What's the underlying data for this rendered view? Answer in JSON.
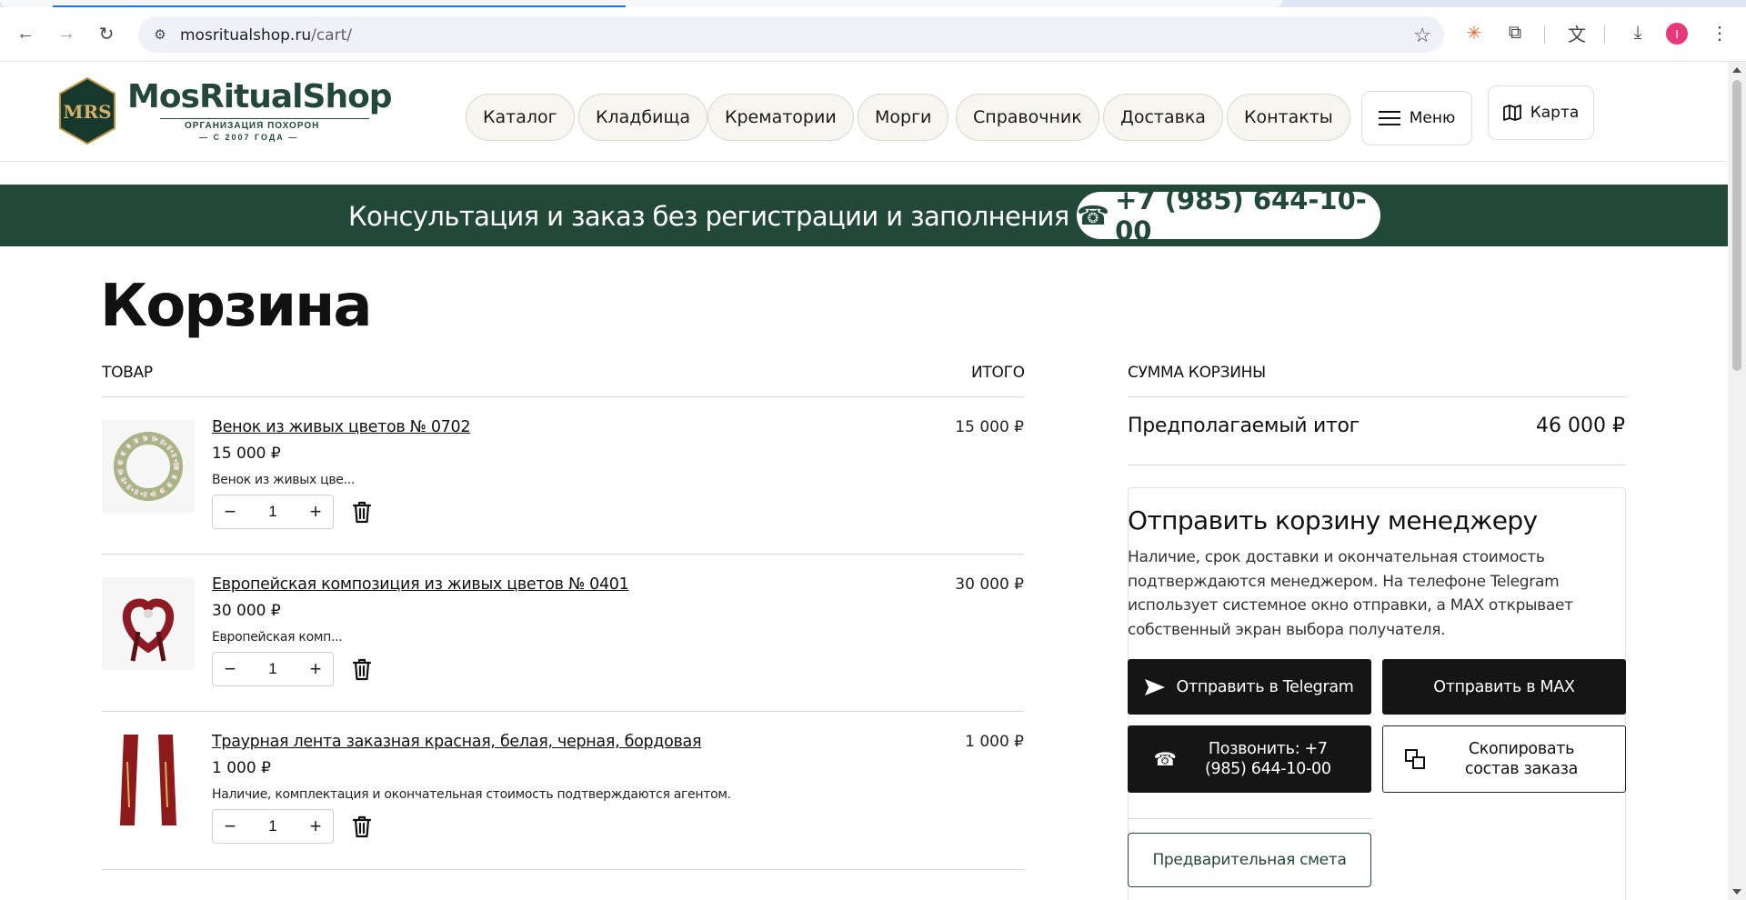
{
  "browser": {
    "url_host": "mosritualshop.ru",
    "url_path": "/cart/"
  },
  "header": {
    "logo_text": "MosRitualShop",
    "logo_monogram": "MRS",
    "logo_sub1": "ОРГАНИЗАЦИЯ ПОХОРОН",
    "logo_sub2": "— С 2007 ГОДА —",
    "nav": [
      "Каталог",
      "Кладбища",
      "Крематории",
      "Морги",
      "Справочник",
      "Доставка",
      "Контакты"
    ],
    "menu_label": "Меню",
    "map_label": "Карта"
  },
  "banner": {
    "text": "Консультация и заказ без регистрации и заполнения форм",
    "phone": "+7 (985) 644-10-00",
    "phone_icon": "☎"
  },
  "cart": {
    "title": "Корзина",
    "col_product": "ТОВАР",
    "col_total": "ИТОГО",
    "items": [
      {
        "name": "Венок из живых цветов № 0702",
        "price": "15 000 ₽",
        "desc": "Венок из живых цве...",
        "qty": "1",
        "total": "15 000 ₽"
      },
      {
        "name": "Европейская композиция из живых цветов № 0401",
        "price": "30 000 ₽",
        "desc": "Европейская комп...",
        "qty": "1",
        "total": "30 000 ₽"
      },
      {
        "name": "Траурная лента заказная красная, белая, черная, бордовая",
        "price": "1 000 ₽",
        "desc": "Наличие, комплектация и окончательная стоимость подтверждаются агентом.",
        "qty": "1",
        "total": "1 000 ₽"
      }
    ],
    "minus_glyph": "−",
    "plus_glyph": "+"
  },
  "summary": {
    "heading": "СУММА КОРЗИНЫ",
    "label": "Предполагаемый итог",
    "value": "46 000 ₽",
    "send_title": "Отправить корзину менеджеру",
    "send_desc": "Наличие, срок доставки и окончательная стоимость подтверждаются менеджером. На телефоне Telegram использует системное окно отправки, а MAX открывает собственный экран выбора получателя.",
    "btn_telegram": "Отправить в Telegram",
    "btn_max": "Отправить в MAX",
    "btn_call": "Позвонить: +7 (985) 644-10-00",
    "btn_copy": "Скопировать состав заказа",
    "btn_estimate": "Предварительная смета"
  },
  "colors": {
    "brand_green": "#224838",
    "button_dark": "#151515"
  }
}
